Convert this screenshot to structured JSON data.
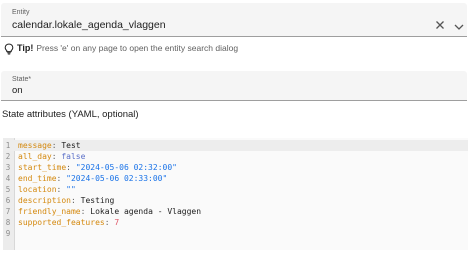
{
  "entity": {
    "label": "Entity",
    "value": "calendar.lokale_agenda_vlaggen",
    "clear_icon": "close-icon",
    "dropdown_icon": "chevron-down-icon"
  },
  "tip": {
    "icon": "lightbulb-icon",
    "bold": "Tip!",
    "text": "Press 'e' on any page to open the entity search dialog"
  },
  "state": {
    "label": "State*",
    "value": "on"
  },
  "attributes": {
    "title": "State attributes (YAML, optional)",
    "lines": [
      {
        "num": "1",
        "key": "message",
        "value": "Test",
        "value_type": "plain"
      },
      {
        "num": "2",
        "key": "all_day",
        "value": "false",
        "value_type": "bool"
      },
      {
        "num": "3",
        "key": "start_time",
        "value": "\"2024-05-06 02:32:00\"",
        "value_type": "string"
      },
      {
        "num": "4",
        "key": "end_time",
        "value": "\"2024-05-06 02:33:00\"",
        "value_type": "string"
      },
      {
        "num": "5",
        "key": "location",
        "value": "\"\"",
        "value_type": "string"
      },
      {
        "num": "6",
        "key": "description",
        "value": "Testing",
        "value_type": "plain"
      },
      {
        "num": "7",
        "key": "friendly_name",
        "value": "Lokale agenda - Vlaggen",
        "value_type": "plain"
      },
      {
        "num": "8",
        "key": "supported_features",
        "value": "7",
        "value_type": "number"
      },
      {
        "num": "9",
        "key": "",
        "value": "",
        "value_type": "empty"
      }
    ]
  },
  "colors": {
    "field_bg": "#f5f5f5",
    "yaml_key": "#d4890f",
    "yaml_string": "#1a73e8",
    "yaml_number": "#e05a6a",
    "yaml_bool": "#5a6fc8"
  }
}
